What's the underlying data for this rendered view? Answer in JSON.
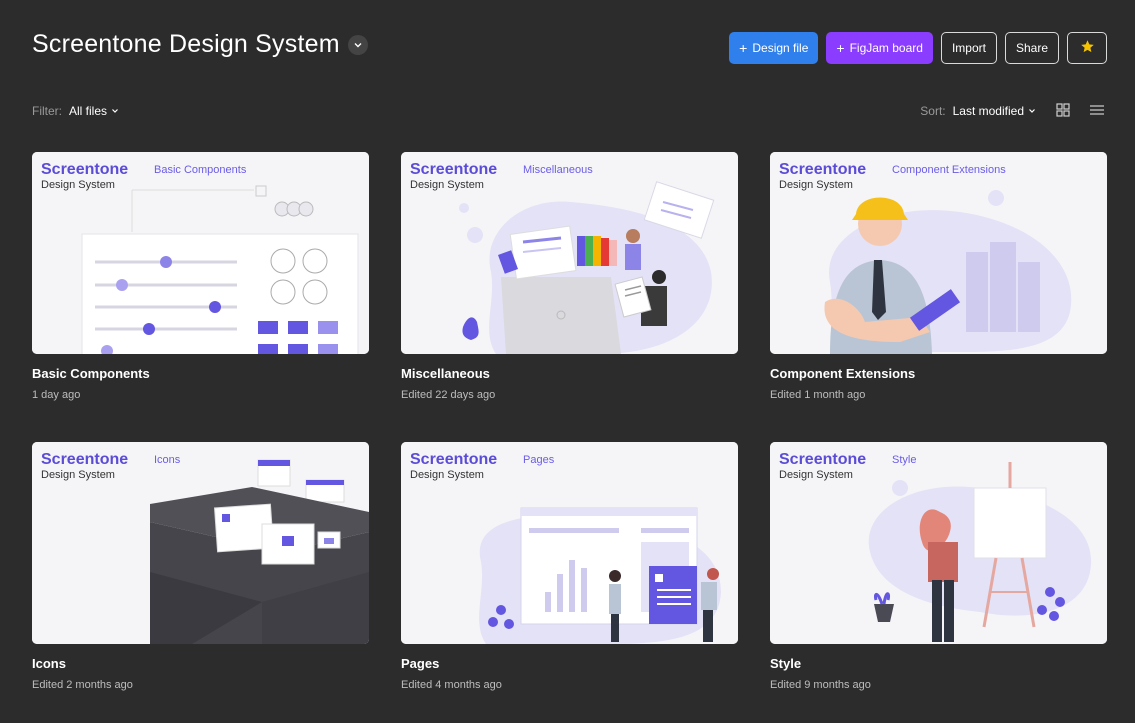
{
  "header": {
    "title": "Screentone Design System",
    "actions": {
      "design_file": "Design file",
      "figjam_board": "FigJam board",
      "import": "Import",
      "share": "Share"
    },
    "icons": {
      "title_caret": "chevron-down-icon",
      "plus": "plus-icon",
      "favorite": "star-icon"
    },
    "colors": {
      "design_file": "#2f80ed",
      "figjam_board": "#8b3dff",
      "star": "#f5c400"
    }
  },
  "toolbar": {
    "filter_label": "Filter:",
    "filter_value": "All files",
    "sort_label": "Sort:",
    "sort_value": "Last modified",
    "view_grid_icon": "grid-view-icon",
    "view_list_icon": "list-view-icon"
  },
  "brand": {
    "name": "Screentone",
    "subtitle": "Design System",
    "accent": "#5b4cd6"
  },
  "files": [
    {
      "tag": "Basic Components",
      "title": "Basic Components",
      "meta": "1 day ago"
    },
    {
      "tag": "Miscellaneous",
      "title": "Miscellaneous",
      "meta": "Edited 22 days ago"
    },
    {
      "tag": "Component Extensions",
      "title": "Component Extensions",
      "meta": "Edited 1 month ago"
    },
    {
      "tag": "Icons",
      "title": "Icons",
      "meta": "Edited 2 months ago"
    },
    {
      "tag": "Pages",
      "title": "Pages",
      "meta": "Edited 4 months ago"
    },
    {
      "tag": "Style",
      "title": "Style",
      "meta": "Edited 9 months ago"
    }
  ]
}
